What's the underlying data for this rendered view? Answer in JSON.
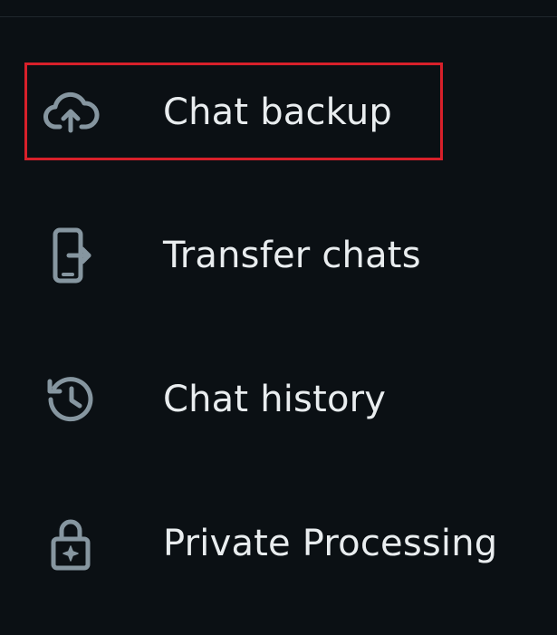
{
  "menu": {
    "items": [
      {
        "label": "Chat backup",
        "icon": "cloud-upload-icon"
      },
      {
        "label": "Transfer chats",
        "icon": "phone-transfer-icon"
      },
      {
        "label": "Chat history",
        "icon": "history-icon"
      },
      {
        "label": "Private Processing",
        "icon": "lock-icon"
      }
    ]
  },
  "highlight": {
    "target": "Chat backup",
    "color": "#d8202a"
  },
  "colors": {
    "background": "#0b1014",
    "text": "#e9edef",
    "icon": "#8696a0"
  }
}
